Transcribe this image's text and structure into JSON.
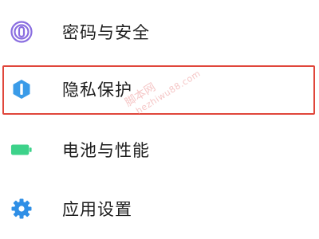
{
  "settings": {
    "items": [
      {
        "label": "密码与安全",
        "icon": "fingerprint-icon",
        "color": "#8a6ee0"
      },
      {
        "label": "隐私保护",
        "icon": "privacy-shield-icon",
        "color": "#3a9be8"
      },
      {
        "label": "电池与性能",
        "icon": "battery-icon",
        "color": "#3dd28a"
      },
      {
        "label": "应用设置",
        "icon": "gear-icon",
        "color": "#2f8fe6"
      }
    ],
    "highlighted_item": "隐私保护",
    "highlight_color": "#e0463b"
  },
  "watermark": {
    "line1": "脚本网",
    "line2": "hezhiwu88.com"
  }
}
